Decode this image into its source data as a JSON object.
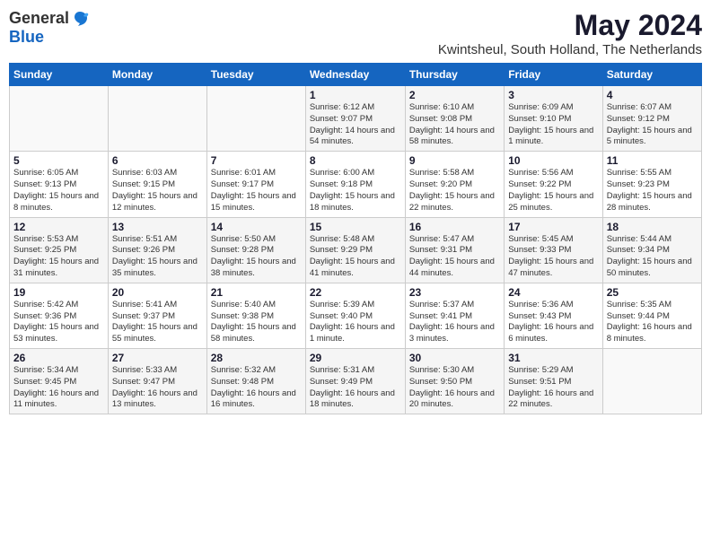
{
  "header": {
    "logo_general": "General",
    "logo_blue": "Blue",
    "month_title": "May 2024",
    "location": "Kwintsheul, South Holland, The Netherlands"
  },
  "weekdays": [
    "Sunday",
    "Monday",
    "Tuesday",
    "Wednesday",
    "Thursday",
    "Friday",
    "Saturday"
  ],
  "weeks": [
    [
      {
        "day": "",
        "info": ""
      },
      {
        "day": "",
        "info": ""
      },
      {
        "day": "",
        "info": ""
      },
      {
        "day": "1",
        "info": "Sunrise: 6:12 AM\nSunset: 9:07 PM\nDaylight: 14 hours\nand 54 minutes."
      },
      {
        "day": "2",
        "info": "Sunrise: 6:10 AM\nSunset: 9:08 PM\nDaylight: 14 hours\nand 58 minutes."
      },
      {
        "day": "3",
        "info": "Sunrise: 6:09 AM\nSunset: 9:10 PM\nDaylight: 15 hours\nand 1 minute."
      },
      {
        "day": "4",
        "info": "Sunrise: 6:07 AM\nSunset: 9:12 PM\nDaylight: 15 hours\nand 5 minutes."
      }
    ],
    [
      {
        "day": "5",
        "info": "Sunrise: 6:05 AM\nSunset: 9:13 PM\nDaylight: 15 hours\nand 8 minutes."
      },
      {
        "day": "6",
        "info": "Sunrise: 6:03 AM\nSunset: 9:15 PM\nDaylight: 15 hours\nand 12 minutes."
      },
      {
        "day": "7",
        "info": "Sunrise: 6:01 AM\nSunset: 9:17 PM\nDaylight: 15 hours\nand 15 minutes."
      },
      {
        "day": "8",
        "info": "Sunrise: 6:00 AM\nSunset: 9:18 PM\nDaylight: 15 hours\nand 18 minutes."
      },
      {
        "day": "9",
        "info": "Sunrise: 5:58 AM\nSunset: 9:20 PM\nDaylight: 15 hours\nand 22 minutes."
      },
      {
        "day": "10",
        "info": "Sunrise: 5:56 AM\nSunset: 9:22 PM\nDaylight: 15 hours\nand 25 minutes."
      },
      {
        "day": "11",
        "info": "Sunrise: 5:55 AM\nSunset: 9:23 PM\nDaylight: 15 hours\nand 28 minutes."
      }
    ],
    [
      {
        "day": "12",
        "info": "Sunrise: 5:53 AM\nSunset: 9:25 PM\nDaylight: 15 hours\nand 31 minutes."
      },
      {
        "day": "13",
        "info": "Sunrise: 5:51 AM\nSunset: 9:26 PM\nDaylight: 15 hours\nand 35 minutes."
      },
      {
        "day": "14",
        "info": "Sunrise: 5:50 AM\nSunset: 9:28 PM\nDaylight: 15 hours\nand 38 minutes."
      },
      {
        "day": "15",
        "info": "Sunrise: 5:48 AM\nSunset: 9:29 PM\nDaylight: 15 hours\nand 41 minutes."
      },
      {
        "day": "16",
        "info": "Sunrise: 5:47 AM\nSunset: 9:31 PM\nDaylight: 15 hours\nand 44 minutes."
      },
      {
        "day": "17",
        "info": "Sunrise: 5:45 AM\nSunset: 9:33 PM\nDaylight: 15 hours\nand 47 minutes."
      },
      {
        "day": "18",
        "info": "Sunrise: 5:44 AM\nSunset: 9:34 PM\nDaylight: 15 hours\nand 50 minutes."
      }
    ],
    [
      {
        "day": "19",
        "info": "Sunrise: 5:42 AM\nSunset: 9:36 PM\nDaylight: 15 hours\nand 53 minutes."
      },
      {
        "day": "20",
        "info": "Sunrise: 5:41 AM\nSunset: 9:37 PM\nDaylight: 15 hours\nand 55 minutes."
      },
      {
        "day": "21",
        "info": "Sunrise: 5:40 AM\nSunset: 9:38 PM\nDaylight: 15 hours\nand 58 minutes."
      },
      {
        "day": "22",
        "info": "Sunrise: 5:39 AM\nSunset: 9:40 PM\nDaylight: 16 hours\nand 1 minute."
      },
      {
        "day": "23",
        "info": "Sunrise: 5:37 AM\nSunset: 9:41 PM\nDaylight: 16 hours\nand 3 minutes."
      },
      {
        "day": "24",
        "info": "Sunrise: 5:36 AM\nSunset: 9:43 PM\nDaylight: 16 hours\nand 6 minutes."
      },
      {
        "day": "25",
        "info": "Sunrise: 5:35 AM\nSunset: 9:44 PM\nDaylight: 16 hours\nand 8 minutes."
      }
    ],
    [
      {
        "day": "26",
        "info": "Sunrise: 5:34 AM\nSunset: 9:45 PM\nDaylight: 16 hours\nand 11 minutes."
      },
      {
        "day": "27",
        "info": "Sunrise: 5:33 AM\nSunset: 9:47 PM\nDaylight: 16 hours\nand 13 minutes."
      },
      {
        "day": "28",
        "info": "Sunrise: 5:32 AM\nSunset: 9:48 PM\nDaylight: 16 hours\nand 16 minutes."
      },
      {
        "day": "29",
        "info": "Sunrise: 5:31 AM\nSunset: 9:49 PM\nDaylight: 16 hours\nand 18 minutes."
      },
      {
        "day": "30",
        "info": "Sunrise: 5:30 AM\nSunset: 9:50 PM\nDaylight: 16 hours\nand 20 minutes."
      },
      {
        "day": "31",
        "info": "Sunrise: 5:29 AM\nSunset: 9:51 PM\nDaylight: 16 hours\nand 22 minutes."
      },
      {
        "day": "",
        "info": ""
      }
    ]
  ]
}
